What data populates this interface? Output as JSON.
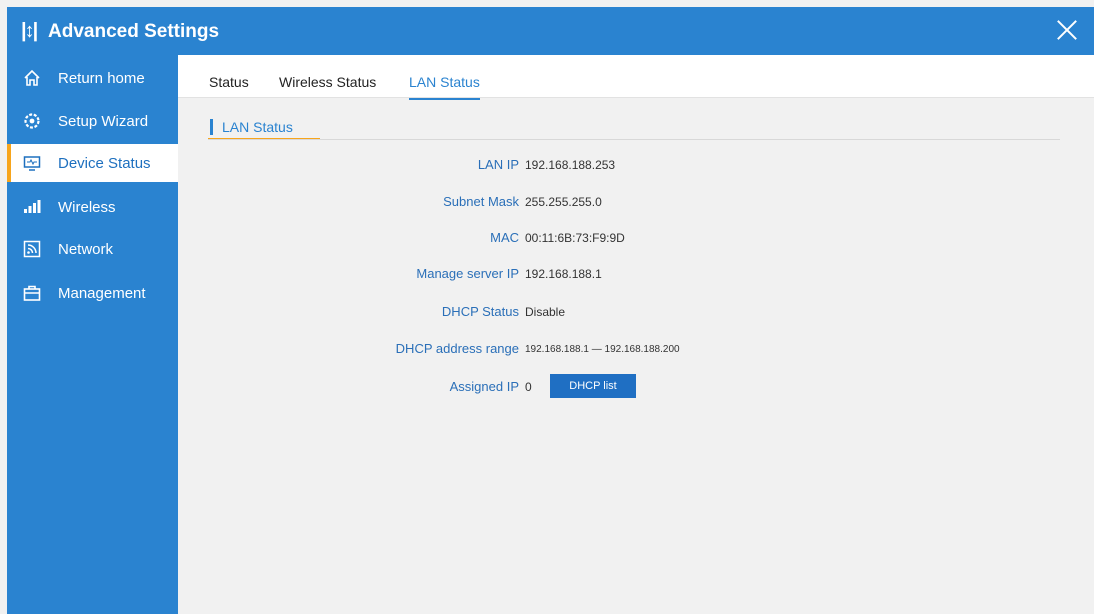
{
  "window": {
    "title": "Advanced Settings",
    "title_icon": "sliders-icon",
    "close_icon": "close-icon"
  },
  "sidebar": {
    "items": [
      {
        "label": "Return home",
        "icon": "home-icon"
      },
      {
        "label": "Setup Wizard",
        "icon": "gear-icon"
      },
      {
        "label": "Device Status",
        "icon": "monitor-icon",
        "active": true
      },
      {
        "label": "Wireless",
        "icon": "signal-bars-icon"
      },
      {
        "label": "Network",
        "icon": "network-icon"
      },
      {
        "label": "Management",
        "icon": "toolbox-icon"
      }
    ]
  },
  "tabs": [
    {
      "label": "Status"
    },
    {
      "label": "Wireless Status"
    },
    {
      "label": "LAN Status",
      "active": true
    }
  ],
  "section": {
    "title": "LAN Status"
  },
  "lan": {
    "lan_ip_label": "LAN IP",
    "lan_ip": "192.168.188.253",
    "subnet_label": "Subnet Mask",
    "subnet": "255.255.255.0",
    "mac_label": "MAC",
    "mac": "00:11:6B:73:F9:9D",
    "manage_label": "Manage server IP",
    "manage_ip": "192.168.188.1",
    "dhcp_status_label": "DHCP Status",
    "dhcp_status": "Disable",
    "dhcp_range_label": "DHCP address range",
    "dhcp_range": "192.168.188.1 — 192.168.188.200",
    "assigned_label": "Assigned IP",
    "assigned": "0",
    "dhcp_list_button": "DHCP list"
  },
  "colors": {
    "primary": "#2a83d0",
    "accent": "#f7a51c",
    "label_blue": "#2a6fb8",
    "button": "#1f6fc3"
  }
}
